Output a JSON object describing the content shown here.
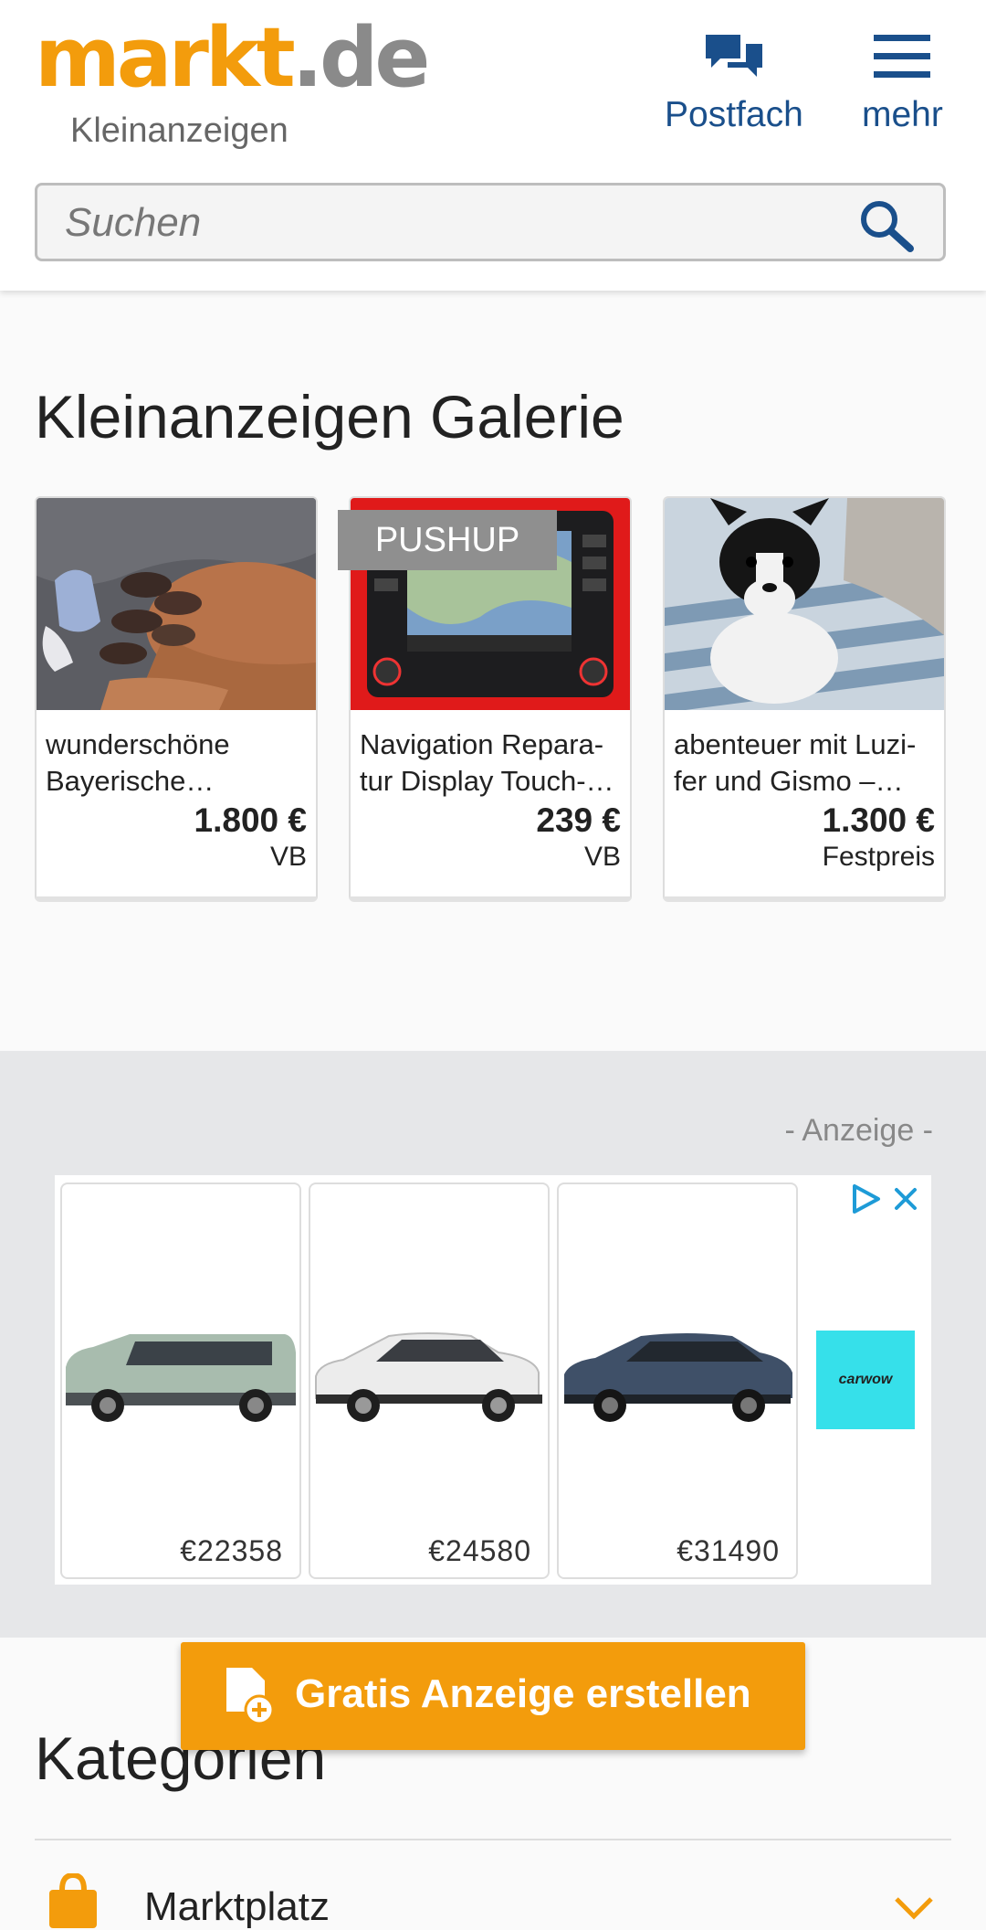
{
  "header": {
    "logo_main": "markt",
    "logo_tld": ".de",
    "tagline": "Kleinanzeigen",
    "postfach_label": "Postfach",
    "mehr_label": "mehr",
    "search_placeholder": "Suchen"
  },
  "gallery": {
    "title": "Kleinanzeigen Galerie",
    "pushup_label": "PUSHUP",
    "items": [
      {
        "title": "wunderschöne Bayerische…",
        "price": "1.800 €",
        "price_type": "VB"
      },
      {
        "title": "Navigation Repara-tur Display Touch-…",
        "price": "239 €",
        "price_type": "VB"
      },
      {
        "title": "abenteuer mit Luzi-fer und Gismo –…",
        "price": "1.300 €",
        "price_type": "Festpreis"
      }
    ]
  },
  "ad": {
    "label": "- Anzeige -",
    "cars": [
      {
        "price": "€22358"
      },
      {
        "price": "€24580"
      },
      {
        "price": "€31490"
      }
    ],
    "brand": "carwow"
  },
  "cta": {
    "label": "Gratis Anzeige erstellen"
  },
  "categories": {
    "title": "Kategorien",
    "first_item": "Marktplatz"
  },
  "colors": {
    "brand_orange": "#f39c0c",
    "link_blue": "#1a4f8b"
  }
}
